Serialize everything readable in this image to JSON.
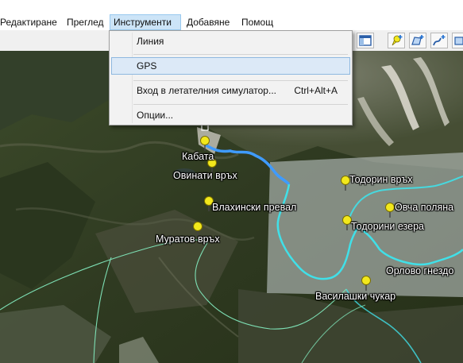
{
  "menubar": {
    "items": [
      "Редактиране",
      "Преглед",
      "Инструменти",
      "Добавяне",
      "Помощ"
    ],
    "active_index": 2
  },
  "tools_menu": {
    "items": [
      {
        "label": "Линия",
        "shortcut": ""
      },
      {
        "label": "GPS",
        "shortcut": ""
      },
      {
        "label": "Вход в летателния симулатор...",
        "shortcut": "Ctrl+Alt+A"
      },
      {
        "label": "Опции...",
        "shortcut": ""
      }
    ],
    "highlighted_index": 1
  },
  "toolbar": {
    "icons": [
      "window-layout-icon",
      "add-placemark-icon",
      "add-polygon-icon",
      "add-path-icon"
    ]
  },
  "map": {
    "places": [
      "Кабата",
      "Овинати връх",
      "Влахински превал",
      "Муратов връх",
      "Тодорин връх",
      "Овча поляна",
      "Тодорини езера",
      "Орлово гнездо",
      "Василашки чукар"
    ],
    "colors": {
      "track_blue": "#3f9bff",
      "track_cyan": "#40e0e8",
      "pin_yellow": "#f2e81c",
      "overlay": "#b9c2c0"
    }
  }
}
